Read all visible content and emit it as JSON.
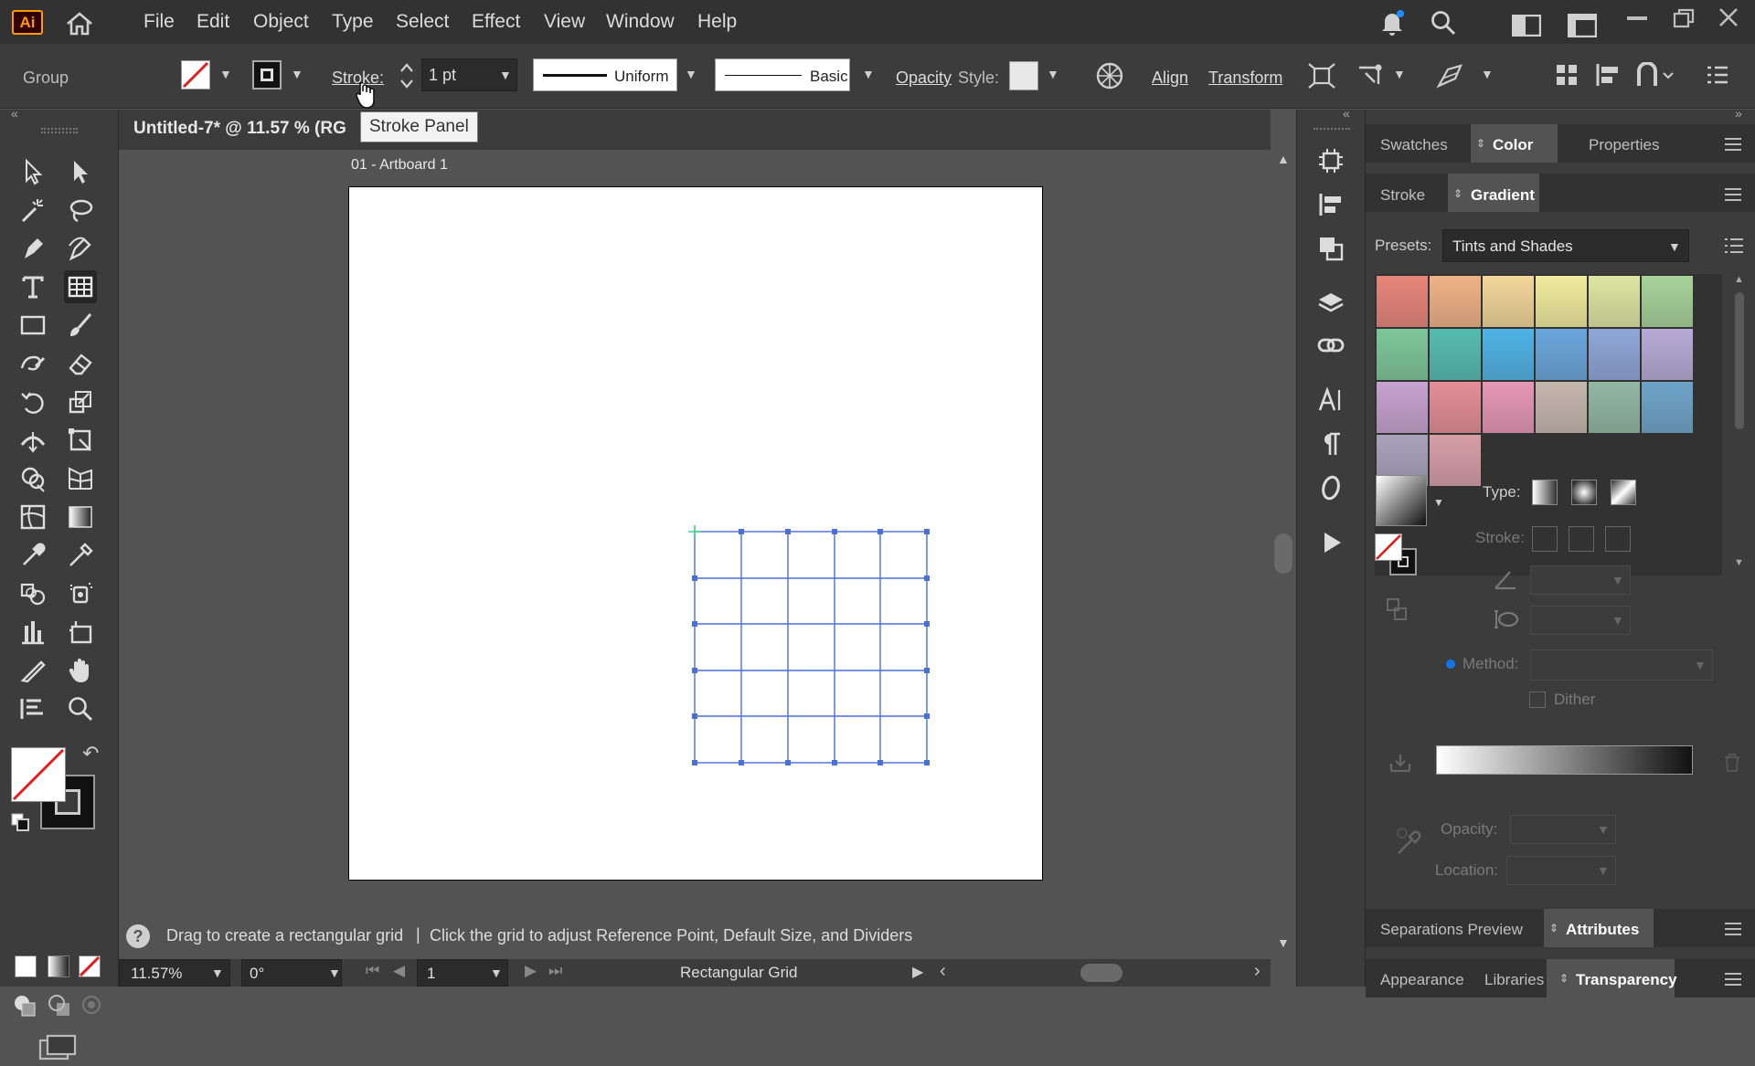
{
  "app": {
    "logo": "Ai"
  },
  "menu": [
    "File",
    "Edit",
    "Object",
    "Type",
    "Select",
    "Effect",
    "View",
    "Window",
    "Help"
  ],
  "control_bar": {
    "selection": "Group",
    "stroke_label": "Stroke:",
    "stroke_weight": "1 pt",
    "profile": "Uniform",
    "brush": "Basic",
    "opacity_label": "Opacity",
    "style_label": "Style:",
    "align_label": "Align",
    "transform_label": "Transform",
    "tooltip": "Stroke Panel"
  },
  "document": {
    "tab_title": "Untitled-7* @ 11.57 % (RG",
    "artboard_label": "01 - Artboard 1"
  },
  "status": {
    "hint_prefix": "Drag to create a rectangular grid",
    "hint_separator": "|",
    "hint_suffix": "Click the grid to adjust Reference Point, Default Size, and Dividers",
    "zoom": "11.57%",
    "rotation": "0°",
    "artboard_number": "1",
    "current_tool": "Rectangular Grid"
  },
  "panels": {
    "top_tabs": [
      "Swatches",
      "Color",
      "Properties"
    ],
    "top_active": "Color",
    "mid_tabs": [
      "Stroke",
      "Gradient"
    ],
    "mid_active": "Gradient",
    "presets_label": "Presets:",
    "presets_value": "Tints and Shades",
    "type_label": "Type:",
    "stroke_label": "Stroke:",
    "method_label": "Method:",
    "dither_label": "Dither",
    "opacity_label": "Opacity:",
    "location_label": "Location:",
    "lower_tabs": [
      "Separations Preview",
      "Attributes"
    ],
    "lower_active": "Attributes",
    "bottom_tabs": [
      "Appearance",
      "Libraries",
      "Transparency"
    ],
    "bottom_active": "Transparency"
  },
  "gradient_swatches": [
    [
      "#e8857a",
      "#f0b287",
      "#f3d79a",
      "#f2ec9e",
      "#dfe6a3",
      "#a8d39a"
    ],
    [
      "#7ec79a",
      "#55bcb0",
      "#4fb3e6",
      "#6aa6dc",
      "#8fa6d8",
      "#b7abd7"
    ],
    [
      "#c7a2cf",
      "#e48d98",
      "#e697b6",
      "#c6b7ae",
      "#93b7a3",
      "#6ea4c9"
    ],
    [
      "#a8a2bc",
      "#d79ea7"
    ]
  ],
  "colors": {
    "accent_blue": "#1473e6",
    "grid_selection": "#4a6fd8",
    "origin_marker": "#3bd18a"
  }
}
